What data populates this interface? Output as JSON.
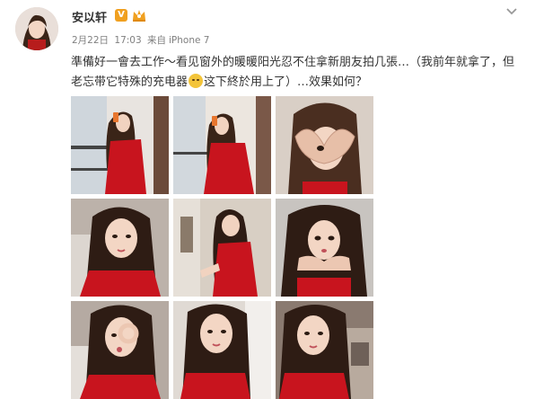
{
  "user": {
    "name": "安以轩",
    "vip_badge": "V"
  },
  "meta": {
    "date": "2月22日",
    "time": "17:03",
    "source_prefix": "来自",
    "source": "iPhone 7"
  },
  "post": {
    "text_before_emoji": "準備好一會去工作～看见窗外的暖暖阳光忍不住拿新朋友拍几張…（我前年就拿了，但老忘带它特殊的充电器",
    "text_after_emoji": "这下終於用上了）…效果如何？",
    "emoji": "sleepy-face-emoji"
  },
  "photos": [
    "photo-1",
    "photo-2",
    "photo-3",
    "photo-4",
    "photo-5",
    "photo-6",
    "photo-7",
    "photo-8",
    "photo-9"
  ],
  "colors": {
    "username": "#333333",
    "meta": "#808080",
    "vip": "#f0a020",
    "dress_red": "#c8141e"
  }
}
